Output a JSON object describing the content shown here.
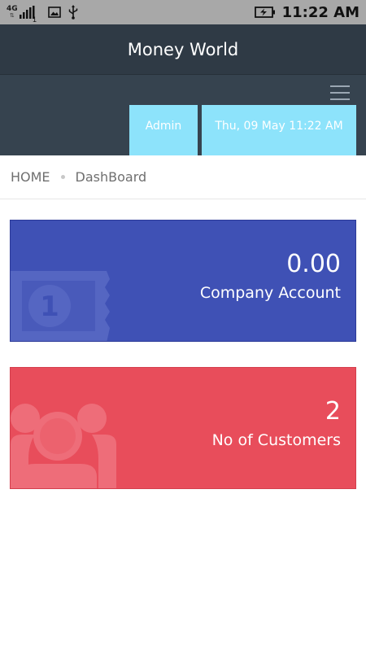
{
  "status_bar": {
    "network": "4G",
    "sim_slot": "1",
    "time": "11:22 AM",
    "icons": [
      "signal-icon",
      "image-icon",
      "usb-icon",
      "battery-charging-icon"
    ]
  },
  "app": {
    "title": "Money World"
  },
  "header": {
    "user_chip": "Admin",
    "datetime_chip": "Thu, 09 May 11:22 AM",
    "menu_icon": "hamburger-menu-icon"
  },
  "breadcrumb": {
    "home": "HOME",
    "current": "DashBoard"
  },
  "cards": [
    {
      "value": "0.00",
      "label": "Company Account",
      "color": "#3f51b5",
      "icon": "banknote-icon"
    },
    {
      "value": "2",
      "label": "No of Customers",
      "color": "#e84d5b",
      "icon": "users-group-icon"
    }
  ],
  "colors": {
    "status_bar": "#a8a8a8",
    "app_header": "#2f3a45",
    "sub_header": "#36434f",
    "chip": "#8de3fb"
  }
}
